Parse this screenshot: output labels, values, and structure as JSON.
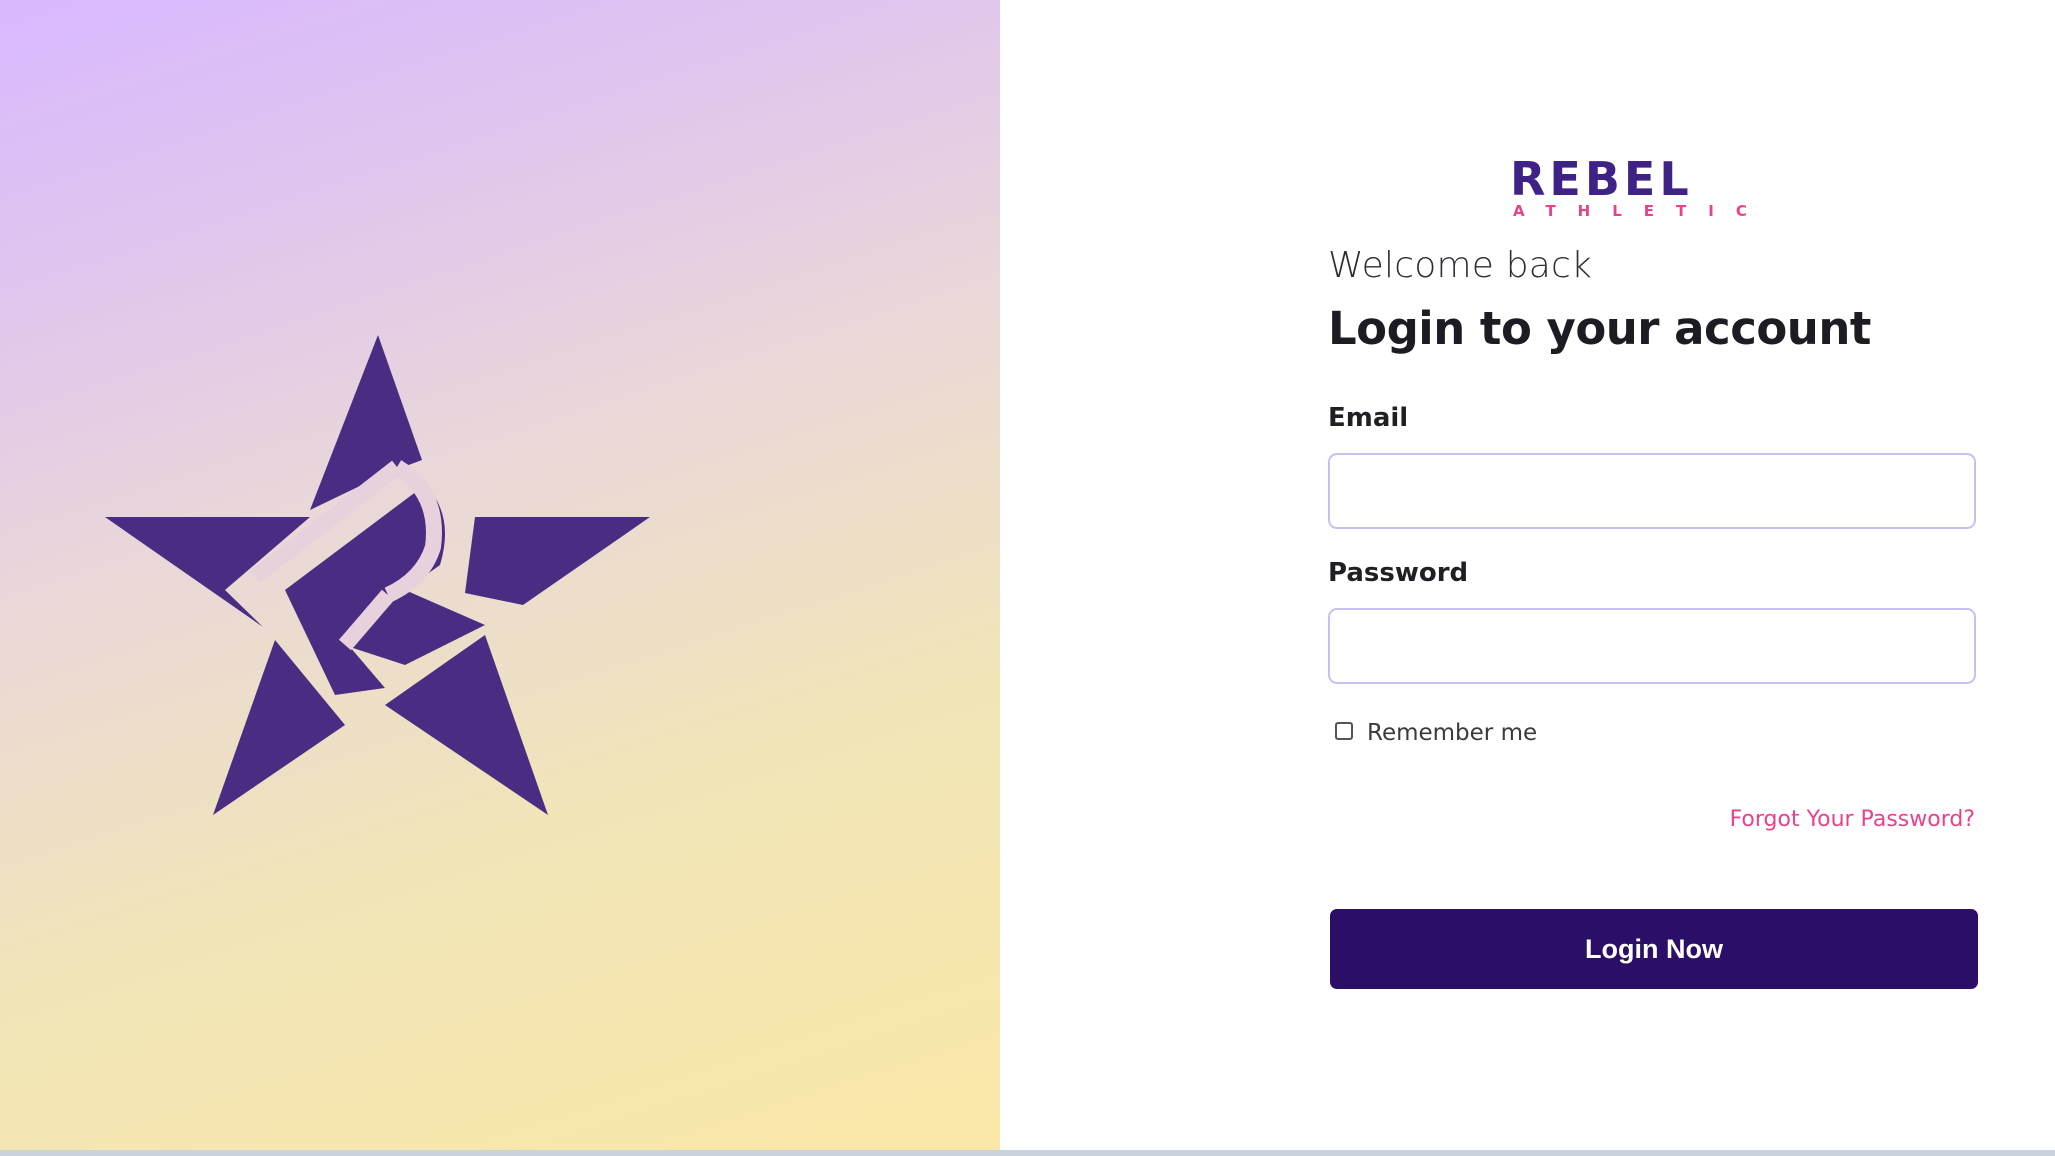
{
  "brand": {
    "logo_primary": "REBEL",
    "logo_secondary": "ATHLETIC",
    "star_color": "#4a2c82",
    "logo_purple": "#3f2285",
    "logo_pink": "#e8438a"
  },
  "heading": {
    "welcome": "Welcome back",
    "title": "Login to your account"
  },
  "form": {
    "email": {
      "label": "Email",
      "value": "",
      "placeholder": ""
    },
    "password": {
      "label": "Password",
      "value": "",
      "placeholder": ""
    },
    "remember": {
      "label": "Remember me",
      "checked": false
    },
    "forgot_link": "Forgot Your Password?",
    "submit_label": "Login Now"
  },
  "colors": {
    "button_bg": "#2b0e68",
    "link": "#e8438a",
    "input_border": "#c9bff0"
  }
}
